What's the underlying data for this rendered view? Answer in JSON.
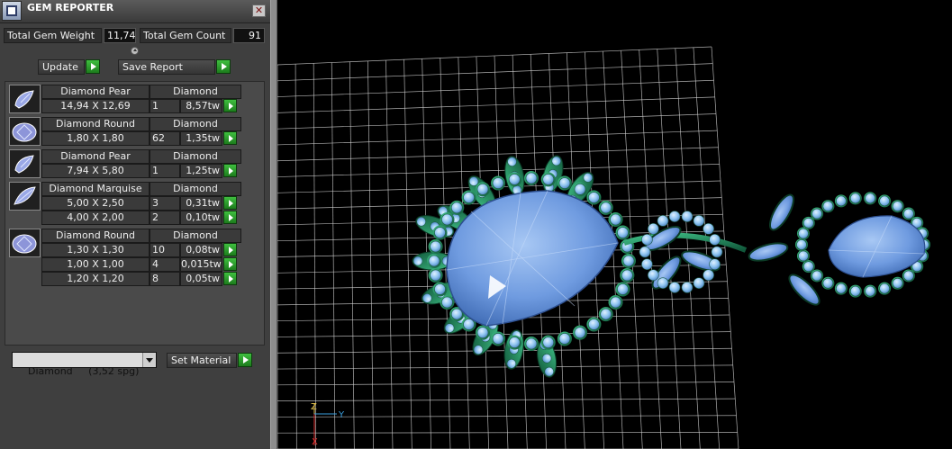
{
  "window": {
    "title": "GEM REPORTER",
    "icon": "gem-reporter-icon",
    "close_icon": "close-icon"
  },
  "totals": {
    "weight_label": "Total Gem Weight",
    "weight_value": "11,74",
    "count_label": "Total Gem Count",
    "count_value": "91"
  },
  "toolbar": {
    "update_label": "Update",
    "save_label": "Save Report"
  },
  "gem_groups": [
    {
      "shape": "Diamond Pear",
      "material": "Diamond",
      "rows": [
        {
          "size": "14,94 X 12,69",
          "count": "1",
          "weight": "8,57tw"
        }
      ]
    },
    {
      "shape": "Diamond Round",
      "material": "Diamond",
      "rows": [
        {
          "size": "1,80 X 1,80",
          "count": "62",
          "weight": "1,35tw"
        }
      ]
    },
    {
      "shape": "Diamond Pear",
      "material": "Diamond",
      "rows": [
        {
          "size": "7,94 X 5,80",
          "count": "1",
          "weight": "1,25tw"
        }
      ]
    },
    {
      "shape": "Diamond Marquise",
      "material": "Diamond",
      "rows": [
        {
          "size": "5,00 X 2,50",
          "count": "3",
          "weight": "0,31tw"
        },
        {
          "size": "4,00 X 2,00",
          "count": "2",
          "weight": "0,10tw"
        }
      ]
    },
    {
      "shape": "Diamond Round",
      "material": "Diamond",
      "rows": [
        {
          "size": "1,30 X 1,30",
          "count": "10",
          "weight": "0,08tw"
        },
        {
          "size": "1,00 X 1,00",
          "count": "4",
          "weight": "0,015tw"
        },
        {
          "size": "1,20 X 1,20",
          "count": "8",
          "weight": "0,05tw"
        }
      ]
    }
  ],
  "material": {
    "selected": "Diamond     (3,52 spg)",
    "set_label": "Set Material"
  },
  "viewport": {
    "axes": {
      "z": "Z",
      "y": "Y",
      "x": "X"
    },
    "colors": {
      "background": "#000000",
      "grid": "#d9d9d9",
      "metal": "#1f8a5a",
      "gem": "#6f9be0",
      "pave": "#8ec4f0",
      "axis_z": "#e0c050",
      "axis_y": "#3aa0e0",
      "axis_x": "#e03030"
    }
  }
}
